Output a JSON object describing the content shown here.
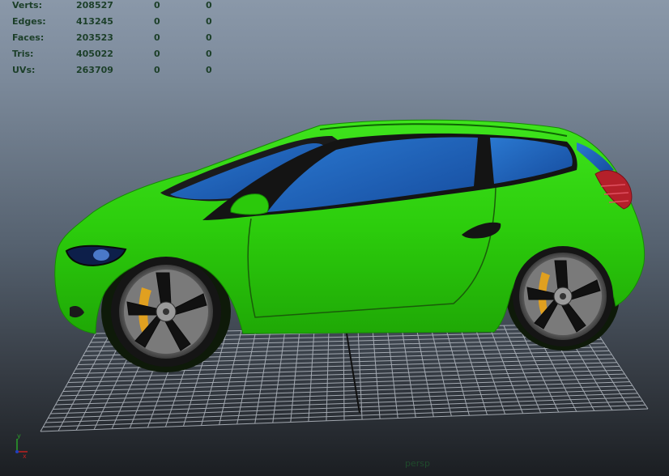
{
  "hud": {
    "rows": [
      {
        "label": "Verts:",
        "v1": "208527",
        "v2": "0",
        "v3": "0"
      },
      {
        "label": "Edges:",
        "v1": "413245",
        "v2": "0",
        "v3": "0"
      },
      {
        "label": "Faces:",
        "v1": "203523",
        "v2": "0",
        "v3": "0"
      },
      {
        "label": "Tris:",
        "v1": "405022",
        "v2": "0",
        "v3": "0"
      },
      {
        "label": "UVs:",
        "v1": "263709",
        "v2": "0",
        "v3": "0"
      }
    ]
  },
  "viewport": {
    "camera_label": "persp"
  },
  "axis_gizmo": {
    "y_label": "y",
    "x_label": "x"
  },
  "colors": {
    "body": "#2fd00e",
    "glass": "#1e5fb8",
    "hud_text": "#1c3f29"
  }
}
